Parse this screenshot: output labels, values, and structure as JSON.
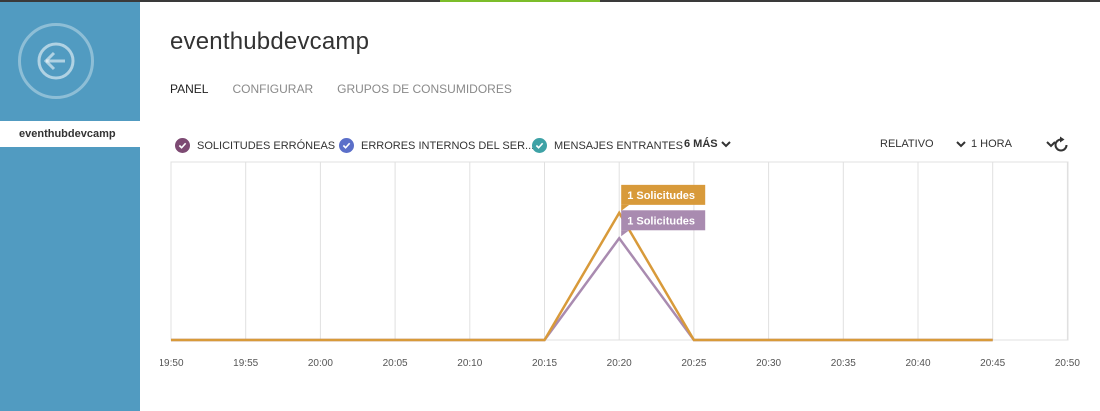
{
  "app": {
    "title": "eventhubdevcamp",
    "sidebar_item": "eventhubdevcamp"
  },
  "tabs": [
    {
      "label": "PANEL",
      "active": true
    },
    {
      "label": "CONFIGURAR",
      "active": false
    },
    {
      "label": "GRUPOS DE CONSUMIDORES",
      "active": false
    }
  ],
  "legend": {
    "items": [
      {
        "label": "SOLICITUDES ERRÓNEAS",
        "color": "#7d4a73"
      },
      {
        "label": "ERRORES INTERNOS DEL SER...",
        "color": "#5b6fc9"
      },
      {
        "label": "MENSAJES ENTRANTES",
        "color": "#3ea2a6"
      }
    ],
    "more_label": "6 MÁS",
    "range_mode": "RELATIVO",
    "range_value": "1 HORA"
  },
  "colors": {
    "sidebar": "#519bc1",
    "series_orange": "#d89a3a",
    "series_purple": "#a98bb0",
    "grid": "#e0e0e0"
  },
  "chart_data": {
    "type": "line",
    "x_ticks": [
      "19:50",
      "19:55",
      "20:00",
      "20:05",
      "20:10",
      "20:15",
      "20:20",
      "20:25",
      "20:30",
      "20:35",
      "20:40",
      "20:45",
      "20:50"
    ],
    "ylim": [
      0,
      1.4
    ],
    "series": [
      {
        "name": "",
        "color": "#d89a3a",
        "x": [
          "19:50",
          "19:55",
          "20:00",
          "20:05",
          "20:10",
          "20:15",
          "20:20",
          "20:25",
          "20:30",
          "20:35",
          "20:40",
          "20:45"
        ],
        "values": [
          0,
          0,
          0,
          0,
          0,
          0,
          1.0,
          0,
          0,
          0,
          0,
          0
        ]
      },
      {
        "name": "",
        "color": "#a98bb0",
        "x": [
          "19:50",
          "19:55",
          "20:00",
          "20:05",
          "20:10",
          "20:15",
          "20:20",
          "20:25",
          "20:30",
          "20:35",
          "20:40",
          "20:45"
        ],
        "values": [
          0,
          0,
          0,
          0,
          0,
          0,
          0.8,
          0,
          0,
          0,
          0,
          0
        ]
      }
    ],
    "tooltips": [
      {
        "label": "1 Solicitudes",
        "series": 0
      },
      {
        "label": "1 Solicitudes",
        "series": 1
      }
    ]
  }
}
